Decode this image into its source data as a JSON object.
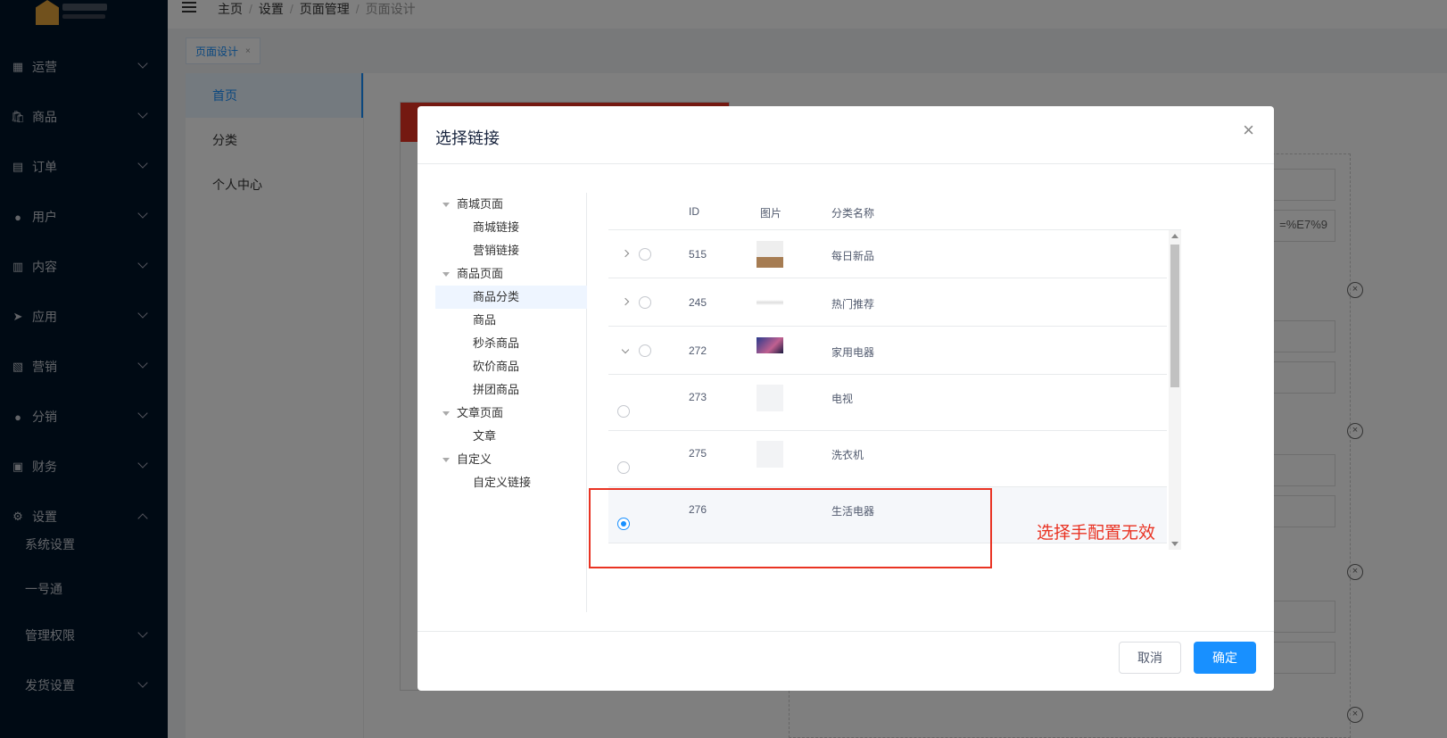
{
  "sidebar": {
    "menus": [
      {
        "label": "运营",
        "icon": "grid-icon"
      },
      {
        "label": "商品",
        "icon": "bag-icon"
      },
      {
        "label": "订单",
        "icon": "clipboard-icon"
      },
      {
        "label": "用户",
        "icon": "user-icon"
      },
      {
        "label": "内容",
        "icon": "book-icon"
      },
      {
        "label": "应用",
        "icon": "send-icon"
      },
      {
        "label": "营销",
        "icon": "chart-icon"
      },
      {
        "label": "分销",
        "icon": "person-icon"
      },
      {
        "label": "财务",
        "icon": "wallet-icon"
      },
      {
        "label": "设置",
        "icon": "gear-icon"
      }
    ],
    "sub": [
      "系统设置",
      "一号通",
      "管理权限",
      "发货设置"
    ]
  },
  "header": {
    "breadcrumbs": [
      "主页",
      "设置",
      "页面管理",
      "页面设计"
    ]
  },
  "tabs": {
    "active": "页面设计"
  },
  "leftnav": [
    "首页",
    "分类",
    "个人中心"
  ],
  "bg": {
    "url_fragment": "=%E7%9"
  },
  "modal": {
    "title": "选择链接",
    "tree": [
      {
        "label": "商城页面",
        "level": 0
      },
      {
        "label": "商城链接",
        "level": 1
      },
      {
        "label": "营销链接",
        "level": 1
      },
      {
        "label": "商品页面",
        "level": 0
      },
      {
        "label": "商品分类",
        "level": 1,
        "selected": true
      },
      {
        "label": "商品",
        "level": 1
      },
      {
        "label": "秒杀商品",
        "level": 1
      },
      {
        "label": "砍价商品",
        "level": 1
      },
      {
        "label": "拼团商品",
        "level": 1
      },
      {
        "label": "文章页面",
        "level": 0
      },
      {
        "label": "文章",
        "level": 1
      },
      {
        "label": "自定义",
        "level": 0
      },
      {
        "label": "自定义链接",
        "level": 1
      }
    ],
    "columns": {
      "id": "ID",
      "image": "图片",
      "name": "分类名称"
    },
    "rows": [
      {
        "id": "515",
        "name": "每日新品",
        "expand": "right",
        "checked": false
      },
      {
        "id": "245",
        "name": "热门推荐",
        "expand": "right",
        "checked": false
      },
      {
        "id": "272",
        "name": "家用电器",
        "expand": "down",
        "checked": false
      },
      {
        "id": "273",
        "name": "电视",
        "expand": "",
        "checked": false
      },
      {
        "id": "275",
        "name": "洗衣机",
        "expand": "",
        "checked": false
      },
      {
        "id": "276",
        "name": "生活电器",
        "expand": "",
        "checked": true
      }
    ],
    "cancel": "取消",
    "ok": "确定"
  },
  "annotation": {
    "note": "选择手配置无效",
    "color": "#e93323"
  }
}
